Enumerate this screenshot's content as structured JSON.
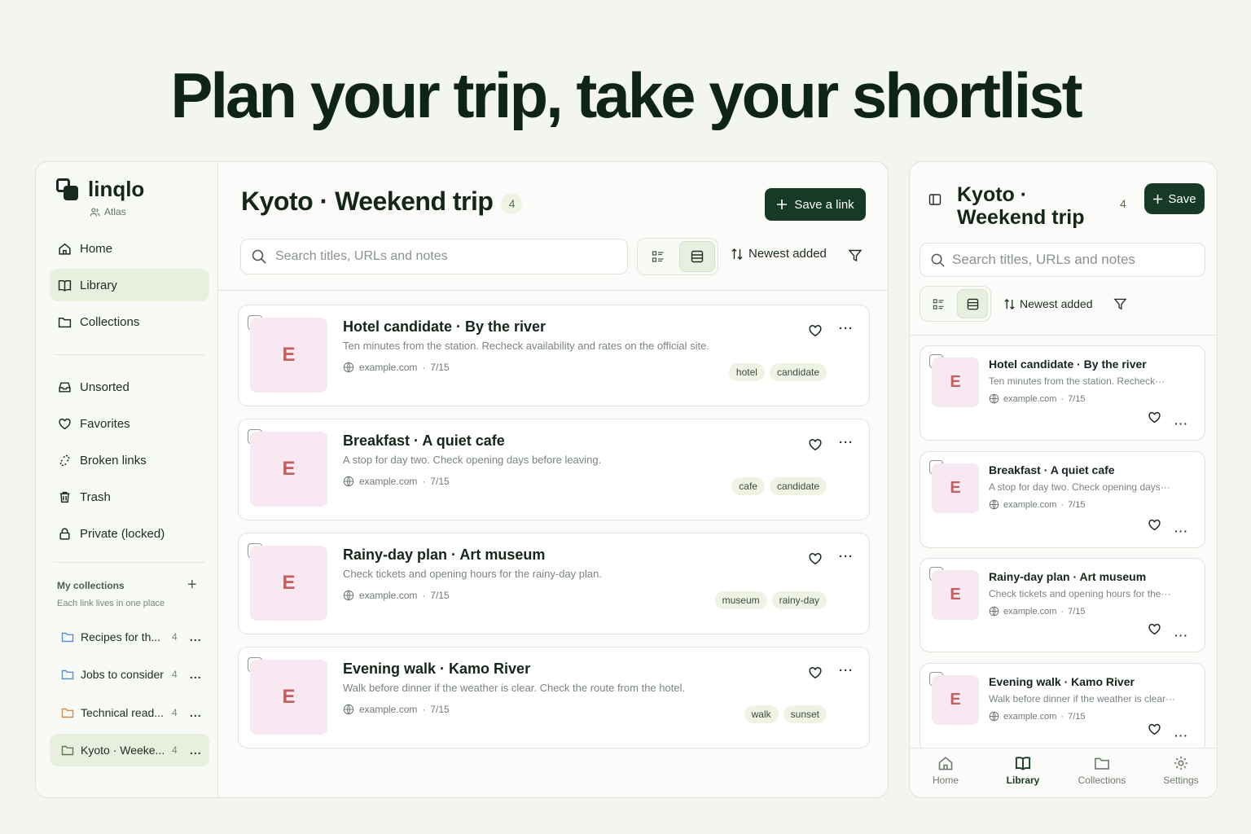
{
  "hero": {
    "headline": "Plan your trip, take your shortlist"
  },
  "sidebar": {
    "brand": "linqlo",
    "workspace": "Atlas",
    "nav_primary": [
      {
        "label": "Home",
        "icon": "home-icon"
      },
      {
        "label": "Library",
        "icon": "book-icon",
        "active": true
      },
      {
        "label": "Collections",
        "icon": "folder-icon"
      }
    ],
    "nav_secondary": [
      {
        "label": "Unsorted",
        "icon": "inbox-icon"
      },
      {
        "label": "Favorites",
        "icon": "heart-icon"
      },
      {
        "label": "Broken links",
        "icon": "broken-link-icon"
      },
      {
        "label": "Trash",
        "icon": "trash-icon"
      },
      {
        "label": "Private (locked)",
        "icon": "lock-icon"
      }
    ],
    "my_collections": {
      "title": "My collections",
      "subtitle": "Each link lives in one place",
      "add_label": "+",
      "items": [
        {
          "name": "Recipes for th...",
          "count": "4",
          "more": "..."
        },
        {
          "name": "Jobs to consider",
          "count": "4",
          "more": "..."
        },
        {
          "name": "Technical read...",
          "count": "4",
          "more": "..."
        },
        {
          "name": "Kyoto · Weeke...",
          "count": "4",
          "more": "...",
          "active": true
        }
      ]
    }
  },
  "main": {
    "title": "Kyoto · Weekend trip",
    "count": "4",
    "save_label": "Save a link",
    "search_placeholder": "Search titles, URLs and notes",
    "sort_label": "Newest added",
    "view_modes": [
      "list-view-icon",
      "card-view-icon"
    ],
    "active_view": "card-view-icon"
  },
  "links": [
    {
      "thumb": "E",
      "title": "Hotel candidate · By the river",
      "note": "Ten minutes from the station. Recheck availability and rates on the official site.",
      "short_note": "Ten minutes from the station. Recheck···",
      "domain": "example.com",
      "date": "7/15",
      "tags": [
        "hotel",
        "candidate"
      ]
    },
    {
      "thumb": "E",
      "title": "Breakfast · A quiet cafe",
      "note": "A stop for day two. Check opening days before leaving.",
      "short_note": "A stop for day two. Check opening days···",
      "domain": "example.com",
      "date": "7/15",
      "tags": [
        "cafe",
        "candidate"
      ]
    },
    {
      "thumb": "E",
      "title": "Rainy-day plan · Art museum",
      "note": "Check tickets and opening hours for the rainy-day plan.",
      "short_note": "Check tickets and opening hours for the···",
      "domain": "example.com",
      "date": "7/15",
      "tags": [
        "museum",
        "rainy-day"
      ]
    },
    {
      "thumb": "E",
      "title": "Evening walk · Kamo River",
      "note": "Walk before dinner if the weather is clear. Check the route from the hotel.",
      "short_note": "Walk before dinner if the weather is clear···",
      "domain": "example.com",
      "date": "7/15",
      "tags": [
        "walk",
        "sunset"
      ]
    }
  ],
  "mobile": {
    "title": "Kyoto · Weekend trip",
    "count": "4",
    "save_label": "Save",
    "search_placeholder": "Search titles, URLs and notes",
    "sort_label": "Newest added",
    "tabs": [
      {
        "label": "Home",
        "icon": "home-icon"
      },
      {
        "label": "Library",
        "icon": "book-icon",
        "active": true
      },
      {
        "label": "Collections",
        "icon": "folder-icon"
      },
      {
        "label": "Settings",
        "icon": "gear-icon"
      }
    ]
  },
  "colors": {
    "accent": "#173a26",
    "active_bg": "#e9efdf",
    "thumb_bg": "#f8e8f1",
    "thumb_letter": "#c2605f",
    "folder_blue": "#5a8fd0",
    "folder_orange": "#d08a4e"
  }
}
